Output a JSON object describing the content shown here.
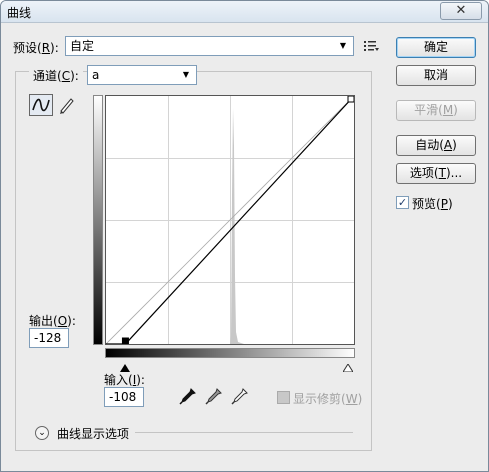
{
  "window": {
    "title": "曲线",
    "close_glyph": "✕"
  },
  "preset": {
    "label": "预设(R):",
    "value": "自定",
    "menu_icon": "list-options-icon"
  },
  "channel": {
    "label": "通道(C):",
    "value": "a"
  },
  "buttons": {
    "ok": "确定",
    "cancel": "取消",
    "smooth": "平滑(M)",
    "auto": "自动(A)",
    "options": "选项(T)..."
  },
  "preview": {
    "label": "预览(P)",
    "checked": true
  },
  "output": {
    "label": "输出(O):",
    "value": "-128"
  },
  "input": {
    "label": "输入(I):",
    "value": "-108"
  },
  "show_clipping": {
    "label": "显示修剪(W)",
    "checked": false
  },
  "curve_options": {
    "label": "曲线显示选项"
  },
  "curve": {
    "points": [
      [
        -108,
        -128
      ],
      [
        127,
        127
      ]
    ],
    "input_range": [
      -128,
      127
    ],
    "output_range": [
      -128,
      127
    ]
  },
  "icons": {
    "curve_tool": "curve-tool-icon",
    "pencil_tool": "pencil-icon",
    "black_eyedropper": "black-eyedropper-icon",
    "gray_eyedropper": "gray-eyedropper-icon",
    "white_eyedropper": "white-eyedropper-icon",
    "expand": "expand-chevron-icon"
  },
  "colors": {
    "accent": "#3c7fb1",
    "histogram": "#c8c8c8"
  }
}
